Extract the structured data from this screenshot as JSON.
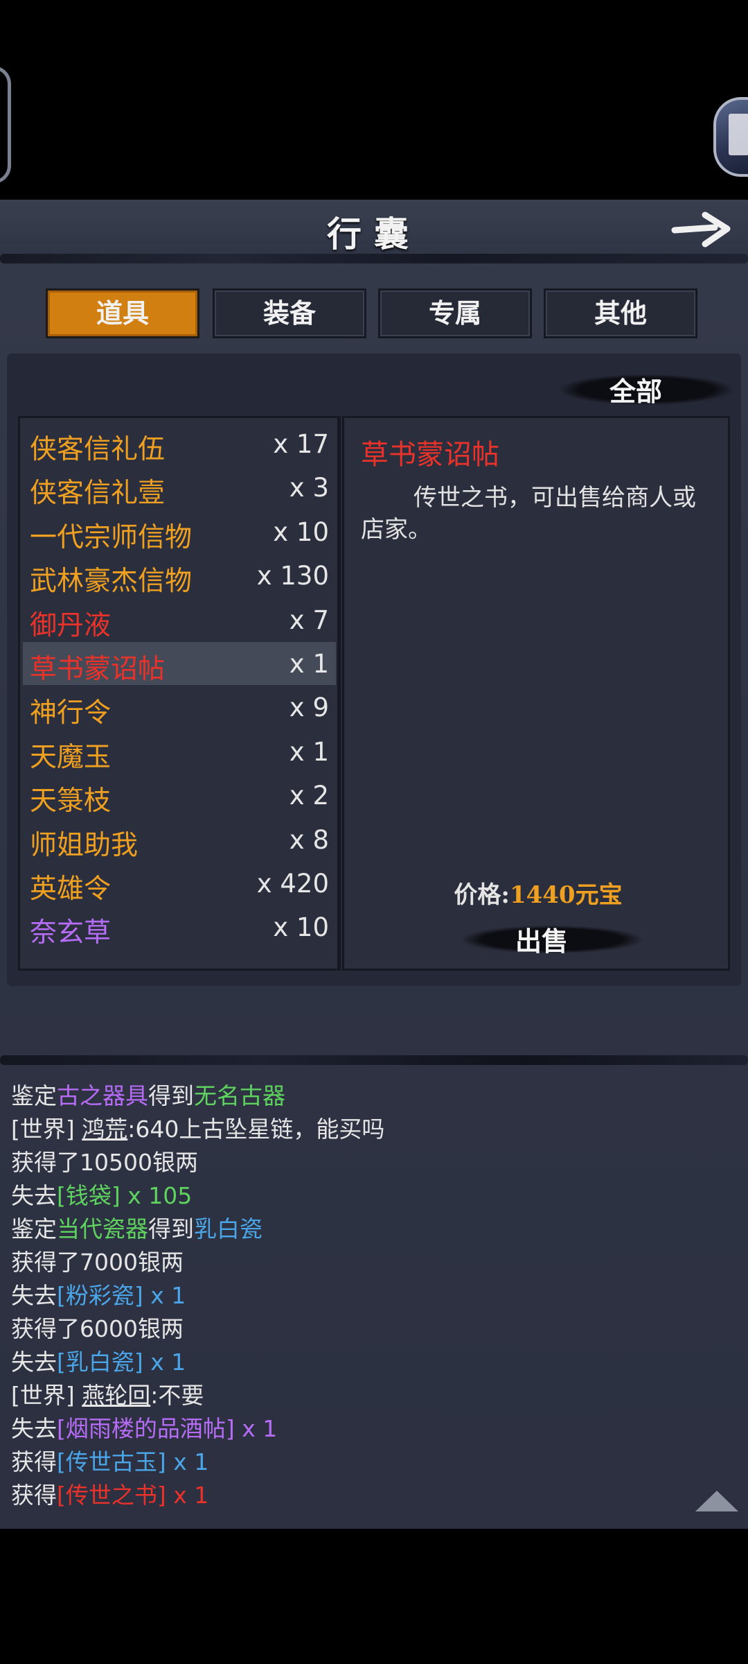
{
  "header": {
    "title": "行囊"
  },
  "tabs": [
    {
      "label": "道具",
      "active": true
    },
    {
      "label": "装备",
      "active": false
    },
    {
      "label": "专属",
      "active": false
    },
    {
      "label": "其他",
      "active": false
    }
  ],
  "filter": {
    "label": "全部"
  },
  "items": [
    {
      "name": "侠客信礼伍",
      "count": "x 17",
      "color": "#f0a020"
    },
    {
      "name": "侠客信礼壹",
      "count": "x 3",
      "color": "#f0a020"
    },
    {
      "name": "一代宗师信物",
      "count": "x 10",
      "color": "#f0a020"
    },
    {
      "name": "武林豪杰信物",
      "count": "x 130",
      "color": "#f0a020"
    },
    {
      "name": "御丹液",
      "count": "x 7",
      "color": "#e8322a"
    },
    {
      "name": "草书蒙诏帖",
      "count": "x 1",
      "color": "#e8322a",
      "selected": true
    },
    {
      "name": "神行令",
      "count": "x 9",
      "color": "#f0a020"
    },
    {
      "name": "天魔玉",
      "count": "x 1",
      "color": "#f0a020"
    },
    {
      "name": "天箓枝",
      "count": "x 2",
      "color": "#f0a020"
    },
    {
      "name": "师姐助我",
      "count": "x 8",
      "color": "#f0a020"
    },
    {
      "name": "英雄令",
      "count": "x 420",
      "color": "#f0a020"
    },
    {
      "name": "奈玄草",
      "count": "x 10",
      "color": "#b66cf5"
    }
  ],
  "detail": {
    "title": "草书蒙诏帖",
    "description": "传世之书，可出售给商人或店家。",
    "price_label": "价格:",
    "price_value": "1440元宝",
    "sell_label": "出售"
  },
  "log": [
    {
      "segs": [
        {
          "t": "鉴定",
          "c": "c-white"
        },
        {
          "t": "古之器具",
          "c": "c-purple"
        },
        {
          "t": "得到",
          "c": "c-white"
        },
        {
          "t": "无名古器",
          "c": "c-green"
        }
      ]
    },
    {
      "segs": [
        {
          "t": "[世界] ",
          "c": "c-white"
        },
        {
          "t": "鸿荒",
          "c": "c-white uname"
        },
        {
          "t": ":640上古坠星链，能买吗",
          "c": "c-white"
        }
      ]
    },
    {
      "segs": [
        {
          "t": "获得了10500银两",
          "c": "c-white"
        }
      ]
    },
    {
      "segs": [
        {
          "t": "失去",
          "c": "c-white"
        },
        {
          "t": "[钱袋] x 105",
          "c": "c-green"
        }
      ]
    },
    {
      "segs": [
        {
          "t": "鉴定",
          "c": "c-white"
        },
        {
          "t": "当代瓷器",
          "c": "c-green"
        },
        {
          "t": "得到",
          "c": "c-white"
        },
        {
          "t": "乳白瓷",
          "c": "c-blue"
        }
      ]
    },
    {
      "segs": [
        {
          "t": "获得了7000银两",
          "c": "c-white"
        }
      ]
    },
    {
      "segs": [
        {
          "t": "失去",
          "c": "c-white"
        },
        {
          "t": "[粉彩瓷] x 1",
          "c": "c-blue"
        }
      ]
    },
    {
      "segs": [
        {
          "t": "获得了6000银两",
          "c": "c-white"
        }
      ]
    },
    {
      "segs": [
        {
          "t": "失去",
          "c": "c-white"
        },
        {
          "t": "[乳白瓷] x 1",
          "c": "c-blue"
        }
      ]
    },
    {
      "segs": [
        {
          "t": "[世界] ",
          "c": "c-white"
        },
        {
          "t": "燕轮回",
          "c": "c-white uname"
        },
        {
          "t": ":不要",
          "c": "c-white"
        }
      ]
    },
    {
      "segs": [
        {
          "t": "失去",
          "c": "c-white"
        },
        {
          "t": "[烟雨楼的品酒帖] x 1",
          "c": "c-purple"
        }
      ]
    },
    {
      "segs": [
        {
          "t": "获得",
          "c": "c-white"
        },
        {
          "t": "[传世古玉] x 1",
          "c": "c-blue"
        }
      ]
    },
    {
      "segs": [
        {
          "t": "获得",
          "c": "c-white"
        },
        {
          "t": "[传世之书] x 1",
          "c": "c-red"
        }
      ]
    }
  ]
}
